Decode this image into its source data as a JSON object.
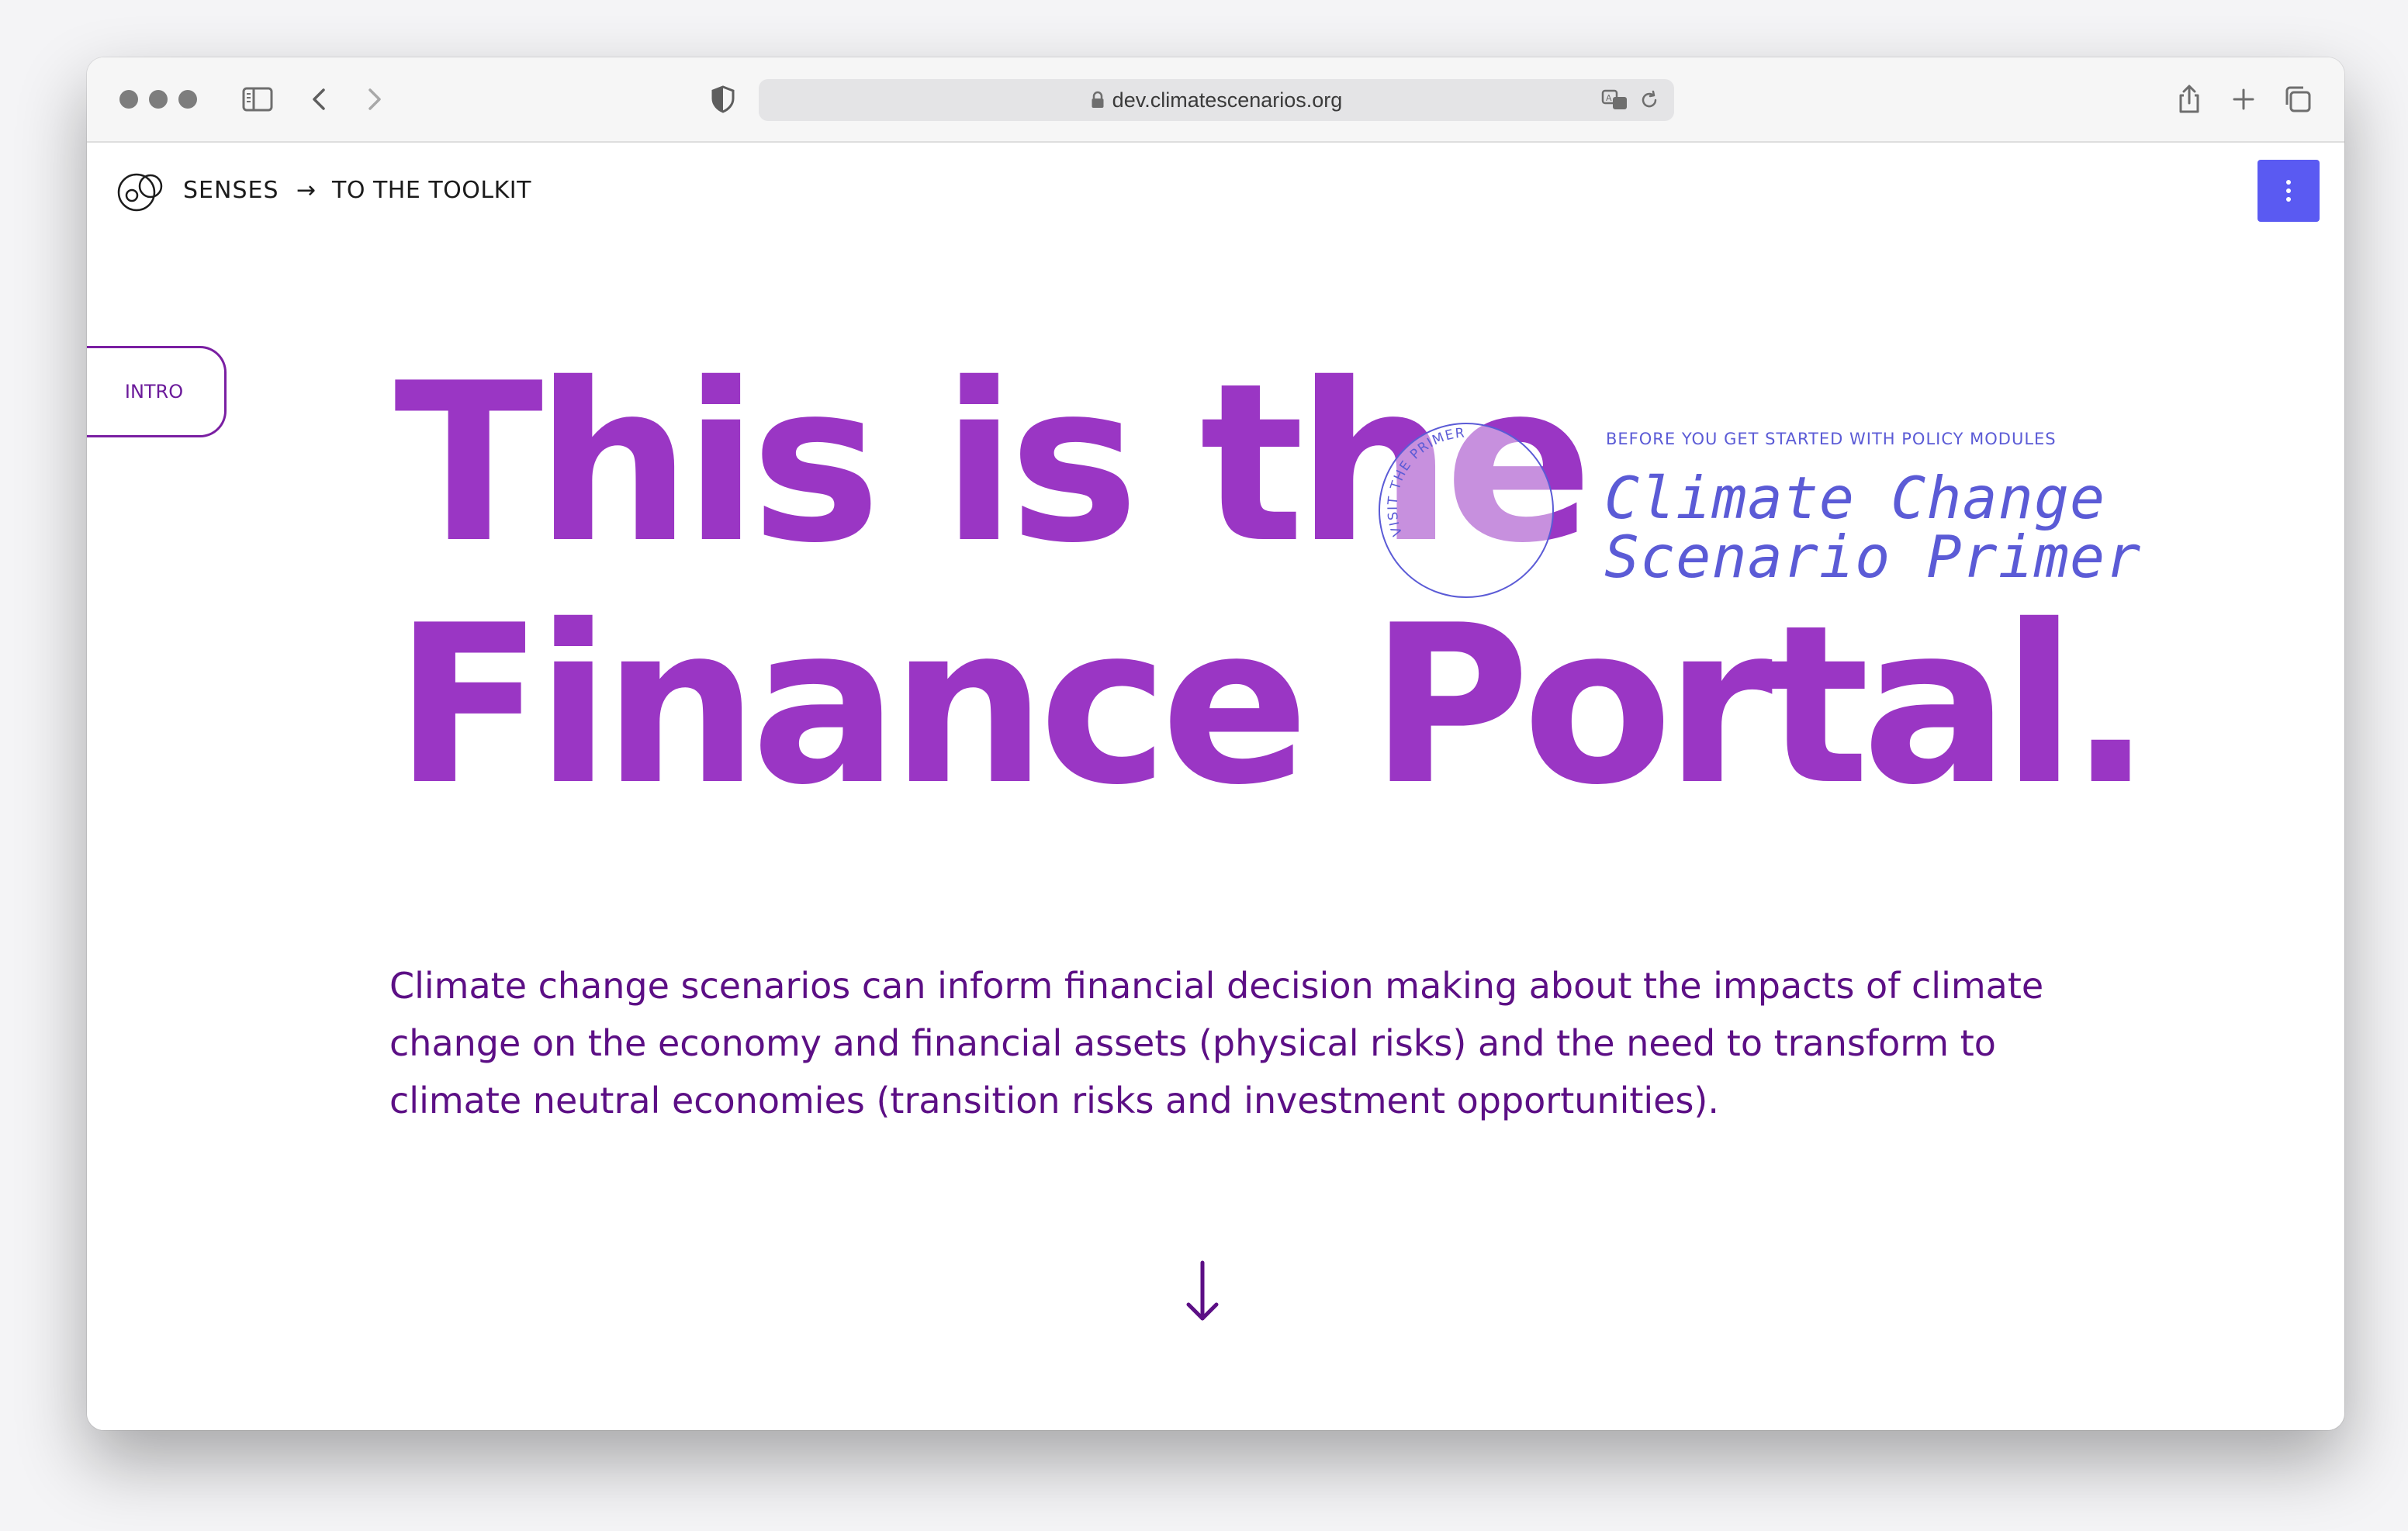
{
  "browser": {
    "url": "dev.climatescenarios.org"
  },
  "nav": {
    "brand": "SENSES",
    "arrow": "→",
    "toolkit_link": "TO THE TOOLKIT"
  },
  "side_tab": {
    "label": "INTRO"
  },
  "hero": {
    "line1": "This is the",
    "line2": "Finance Portal."
  },
  "primer": {
    "circle_label": "VISIT THE PRIMER",
    "eyebrow": "BEFORE YOU GET STARTED WITH POLICY MODULES",
    "title_line1": "Climate Change",
    "title_line2": "Scenario Primer"
  },
  "intro": {
    "text": "Climate change scenarios can inform financial decision making about the impacts of climate change on the economy and financial assets (physical risks) and the need to transform to climate neutral economies (transition risks and investment opportunities)."
  },
  "colors": {
    "headline": "#9a36c4",
    "body_text": "#5c0f85",
    "accent": "#5a5af2"
  },
  "icons": {
    "scroll": "arrow-down-icon",
    "menu": "vertical-dots-icon"
  }
}
